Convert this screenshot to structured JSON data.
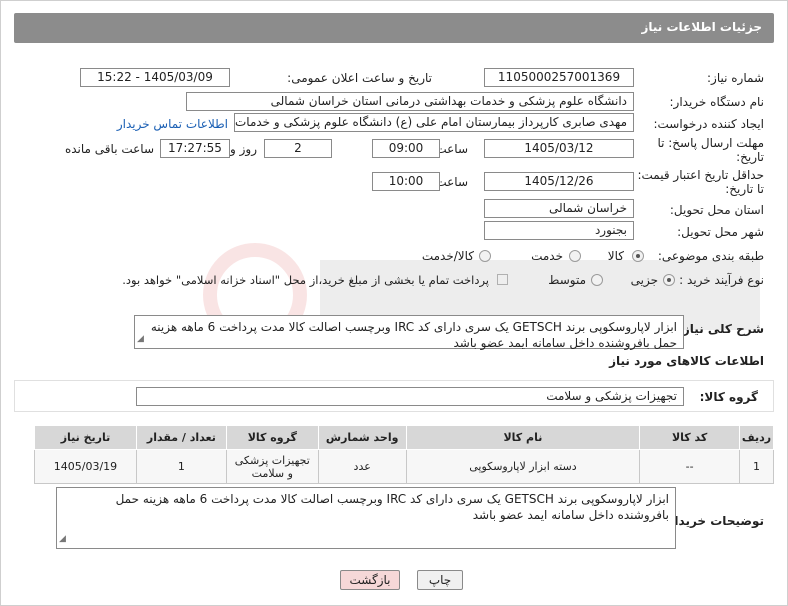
{
  "header": {
    "title": "جزئیات اطلاعات نیاز"
  },
  "need_number": {
    "label": "شماره نیاز:",
    "value": "1105000257001369"
  },
  "announce_datetime": {
    "label": "تاریخ و ساعت اعلان عمومی:",
    "value": "1405/03/09 - 15:22"
  },
  "buyer_org": {
    "label": "نام دستگاه خریدار:",
    "value": "دانشگاه علوم پزشکی و خدمات بهداشتی درمانی استان خراسان شمالی"
  },
  "requester": {
    "label": "ایجاد کننده درخواست:",
    "value": "مهدی صابری کارپرداز بیمارستان امام علی (ع) دانشگاه علوم پزشکی و خدمات ب",
    "contact_link": "اطلاعات تماس خریدار"
  },
  "reply_deadline": {
    "label_line1": "مهلت ارسال پاسخ: تا",
    "label_line2": "تاریخ:",
    "date": "1405/03/12",
    "time_label": "ساعت",
    "time": "09:00",
    "days": "2",
    "days_label": "روز و",
    "remaining": "17:27:55",
    "remaining_label": "ساعت باقی مانده"
  },
  "price_validity": {
    "label_line1": "حداقل تاریخ اعتبار قیمت:",
    "label_line2": "تا تاریخ:",
    "date": "1405/12/26",
    "time_label": "ساعت",
    "time": "10:00"
  },
  "delivery_province": {
    "label": "استان محل تحویل:",
    "value": "خراسان شمالی"
  },
  "delivery_city": {
    "label": "شهر محل تحویل:",
    "value": "بجنورد"
  },
  "category": {
    "label": "طبقه بندی موضوعی:",
    "options": [
      "کالا",
      "خدمت",
      "کالا/خدمت"
    ],
    "selected": "کالا"
  },
  "purchase_type": {
    "label": "نوع فرآیند خرید :",
    "options": [
      "جزیی",
      "متوسط"
    ],
    "selected": "جزیی",
    "note": "پرداخت تمام یا بخشی از مبلغ خرید،از محل \"اسناد خزانه اسلامی\" خواهد بود."
  },
  "description": {
    "label": "شرح کلی نیاز:",
    "value": "ابزار لاپاروسکوپی برند GETSCH یک سری دارای کد IRC وبرچسب اصالت  کالا مدت پرداخت 6 ماهه هزینه حمل بافروشنده داخل سامانه ایمد عضو باشد"
  },
  "goods_info": {
    "title": "اطلاعات کالاهای مورد نیاز"
  },
  "goods_group": {
    "label": "گروه کالا:",
    "value": "تجهیزات پزشکی و سلامت"
  },
  "table": {
    "headers": [
      "ردیف",
      "کد کالا",
      "نام کالا",
      "واحد شمارش",
      "گروه کالا",
      "تعداد / مقدار",
      "تاریخ نیاز"
    ],
    "rows": [
      [
        "1",
        "--",
        "دسته ابزار لاپاروسکوپی",
        "عدد",
        "تجهیزات پزشکی و سلامت",
        "1",
        "1405/03/19"
      ]
    ]
  },
  "buyer_notes": {
    "label": "توضیحات خریدار:",
    "value": "ابزار لاپاروسکوپی برند GETSCH یک سری دارای کد IRC وبرچسب اصالت  کالا مدت پرداخت 6 ماهه هزینه حمل بافروشنده داخل سامانه ایمد عضو باشد"
  },
  "buttons": {
    "print": "چاپ",
    "back": "بازگشت"
  },
  "colors": {
    "title_bar": "#8c8c8c",
    "back_button": "#f6d8d8",
    "print_button": "#f0f0f0",
    "link": "#1a5fb4"
  }
}
